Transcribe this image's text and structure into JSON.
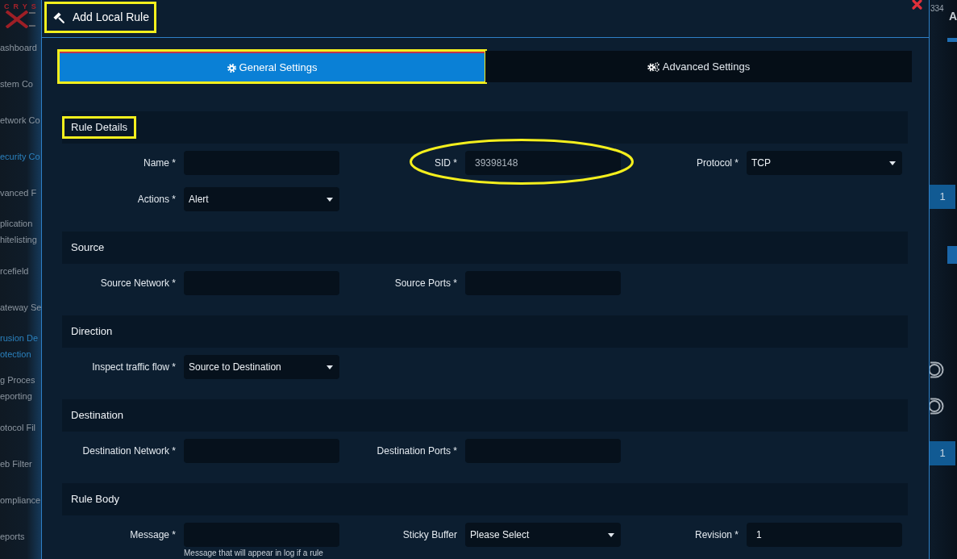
{
  "sidebar": {
    "logo_text": "CRYS",
    "items": [
      {
        "lines": [
          "ashboard"
        ],
        "selected": false
      },
      {
        "lines": [
          "stem Co"
        ],
        "selected": false
      },
      {
        "lines": [
          "etwork Co"
        ],
        "selected": false
      },
      {
        "lines": [
          "ecurity Co"
        ],
        "selected": true
      },
      {
        "lines": [
          "vanced F"
        ],
        "selected": false
      },
      {
        "lines": [
          "plication",
          "hitelisting"
        ],
        "selected": false
      },
      {
        "lines": [
          "rcefield"
        ],
        "selected": false
      },
      {
        "lines": [
          "ateway Se"
        ],
        "selected": false
      },
      {
        "lines": [
          "rusion De",
          "otection"
        ],
        "selected": true
      },
      {
        "lines": [
          "g Proces",
          "eporting"
        ],
        "selected": false
      },
      {
        "lines": [
          "otocol Fil"
        ],
        "selected": false
      },
      {
        "lines": [
          "eb Filter"
        ],
        "selected": false
      },
      {
        "lines": [
          "ompliance"
        ],
        "selected": false
      },
      {
        "lines": [
          "eports"
        ],
        "selected": false
      }
    ]
  },
  "dialog": {
    "title": "Add Local Rule",
    "title_highlighted": true,
    "tabs": [
      {
        "label": "General Settings",
        "selected": true,
        "highlighted": true
      },
      {
        "label": "Advanced Settings",
        "selected": false,
        "highlighted": false
      }
    ],
    "sections": [
      {
        "title": "Rule Details",
        "highlighted": true,
        "rows": [
          {
            "fields": [
              {
                "label": "Name *",
                "kind": "text",
                "highlighted": false
              },
              {
                "label": "SID *",
                "kind": "text",
                "value": "39398148",
                "disabled": true,
                "highlighted": true
              },
              {
                "label": "Protocol *",
                "kind": "select",
                "value": "TCP",
                "disabled": false,
                "highlighted": false
              }
            ]
          },
          {
            "fields": [
              {
                "label": "Actions *",
                "kind": "select",
                "value": "Alert",
                "disabled": false,
                "highlighted": false
              }
            ]
          }
        ]
      },
      {
        "title": "Source",
        "highlighted": false,
        "rows": [
          {
            "fields": [
              {
                "label": "Source Network *",
                "kind": "text",
                "highlighted": false
              },
              {
                "label": "Source Ports *",
                "kind": "text",
                "highlighted": false
              }
            ]
          }
        ]
      },
      {
        "title": "Direction",
        "highlighted": false,
        "rows": [
          {
            "fields": [
              {
                "label": "Inspect traffic flow *",
                "kind": "select",
                "value": "Source to Destination",
                "disabled": false,
                "highlighted": false
              }
            ]
          }
        ]
      },
      {
        "title": "Destination",
        "highlighted": false,
        "rows": [
          {
            "fields": [
              {
                "label": "Destination Network *",
                "kind": "text",
                "highlighted": false
              },
              {
                "label": "Destination Ports *",
                "kind": "text",
                "highlighted": false
              }
            ]
          }
        ]
      },
      {
        "title": "Rule Body",
        "highlighted": false,
        "rows": [
          {
            "fields": [
              {
                "label": "Message *",
                "kind": "text",
                "highlighted": false,
                "help": "Message that will appear in log if a rule"
              },
              {
                "label": "Sticky Buffer",
                "kind": "select",
                "value": "Please Select",
                "disabled": false,
                "highlighted": false
              },
              {
                "label": "Revision *",
                "kind": "text",
                "value": "1",
                "disabled": false,
                "highlighted": false
              }
            ]
          }
        ]
      }
    ]
  },
  "background_panel": {
    "notification_count": "334",
    "heading": "A",
    "page_buttons": [
      "1",
      "1"
    ]
  }
}
